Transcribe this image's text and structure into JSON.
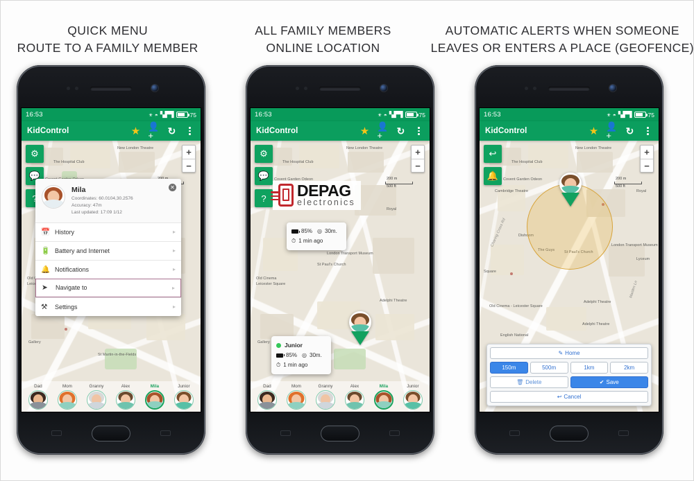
{
  "headings": [
    {
      "line1": "QUICK MENU",
      "line2": "ROUTE TO A FAMILY MEMBER"
    },
    {
      "line1": "ALL FAMILY MEMBERS",
      "line2": "ONLINE LOCATION"
    },
    {
      "line1": "AUTOMATIC ALERTS WHEN SOMEONE",
      "line2": "LEAVES OR ENTERS A PLACE (GEOFENCE)"
    }
  ],
  "status_bar": {
    "time": "16:53",
    "battery_percent": "75",
    "icons": [
      "bluetooth-icon",
      "wifi-icon",
      "signal-icon",
      "battery-icon"
    ]
  },
  "app_bar": {
    "title": "KidControl",
    "actions": [
      "star-icon",
      "add-person-icon",
      "refresh-icon",
      "overflow-menu-icon"
    ],
    "green": "#0b9e5e"
  },
  "map": {
    "scale_label": "200 m",
    "scale_label_ft": "500 ft",
    "zoom_in": "+",
    "zoom_out": "−",
    "labels_1": [
      "New London Theatre",
      "The Hospital Club",
      "Covent Garden Odeon",
      "Cambridge Theatre",
      "St Paul's Church",
      "Adelphi Theatre",
      "Old Cinema",
      "Leicester Square",
      "St Martin-in-the-Fields",
      "Gallery",
      "Royal",
      "Square"
    ],
    "labels_3": [
      "Cambridge Theatre",
      "Dishoom",
      "The Guys",
      "St Paul's Church",
      "London Transport Museum",
      "Adelphi Theatre",
      "English National",
      "Old Cinema - Leicester Square",
      "Charing Cross Rd",
      "Maiden Ln",
      "New London Theatre",
      "The Hospital Club",
      "Covent Garden Odeon",
      "Square",
      "Royal",
      "Lyceum"
    ]
  },
  "phone1": {
    "tools": [
      "settings-gear-icon",
      "chat-icon",
      "help-icon"
    ],
    "popup": {
      "name": "Mila",
      "coordinates": "Coordinates: 60.0104,30.2576",
      "accuracy": "Accuracy: 47m",
      "last_updated": "Last updated: 17:09 1/12",
      "close": "✕",
      "menu": [
        {
          "label": "History",
          "icon": "calendar-icon",
          "highlighted": false
        },
        {
          "label": "Battery and Internet",
          "icon": "battery-icon",
          "highlighted": false
        },
        {
          "label": "Notifications",
          "icon": "bell-icon",
          "highlighted": false
        },
        {
          "label": "Navigate to",
          "icon": "navigate-arrow-icon",
          "highlighted": true
        },
        {
          "label": "Settings",
          "icon": "tools-icon",
          "highlighted": false
        }
      ]
    }
  },
  "phone2": {
    "tools": [
      "settings-gear-icon",
      "chat-icon",
      "help-icon"
    ],
    "watermark": {
      "brand": "DEPAG",
      "sub": "electronics"
    },
    "card_top": {
      "battery": "85%",
      "distance": "30m.",
      "time": "1 min ago"
    },
    "card_bottom": {
      "name": "Junior",
      "battery": "85%",
      "distance": "30m.",
      "time": "1 min ago"
    }
  },
  "phone3": {
    "tools": [
      "back-arrow-icon",
      "bell-icon"
    ],
    "geofence": {
      "place_name": "Home",
      "edit_icon": "pencil-icon",
      "radii": [
        {
          "label": "150m",
          "selected": true
        },
        {
          "label": "500m",
          "selected": false
        },
        {
          "label": "1km",
          "selected": false
        },
        {
          "label": "2km",
          "selected": false
        }
      ],
      "delete_label": "Delete",
      "delete_icon": "trash-icon",
      "save_label": "Save",
      "save_icon": "check-icon",
      "cancel_label": "Cancel",
      "cancel_icon": "undo-arrow-icon",
      "accent": "#3b86e8",
      "circle_color": "#e8b23a"
    }
  },
  "family": [
    {
      "name": "Dad",
      "selected": false,
      "hair": "#3b2a20",
      "skin": "#eab88f",
      "shirt": "#8a9199"
    },
    {
      "name": "Mom",
      "selected": false,
      "hair": "#e0712c",
      "skin": "#f3c6a5",
      "shirt": "#8ed0c0"
    },
    {
      "name": "Granny",
      "selected": false,
      "hair": "#d8d8d8",
      "skin": "#f0c4a4",
      "shirt": "#cfd6dc"
    },
    {
      "name": "Alex",
      "selected": false,
      "hair": "#6b4a2e",
      "skin": "#f3c6a5",
      "shirt": "#6fc3ae"
    },
    {
      "name": "Mila",
      "selected": true,
      "hair": "#a8522a",
      "skin": "#f3c6a5",
      "shirt": "#8ed0c0"
    },
    {
      "name": "Junior",
      "selected": false,
      "hair": "#7a4f2c",
      "skin": "#f3c6a5",
      "shirt": "#57c0a6"
    }
  ]
}
